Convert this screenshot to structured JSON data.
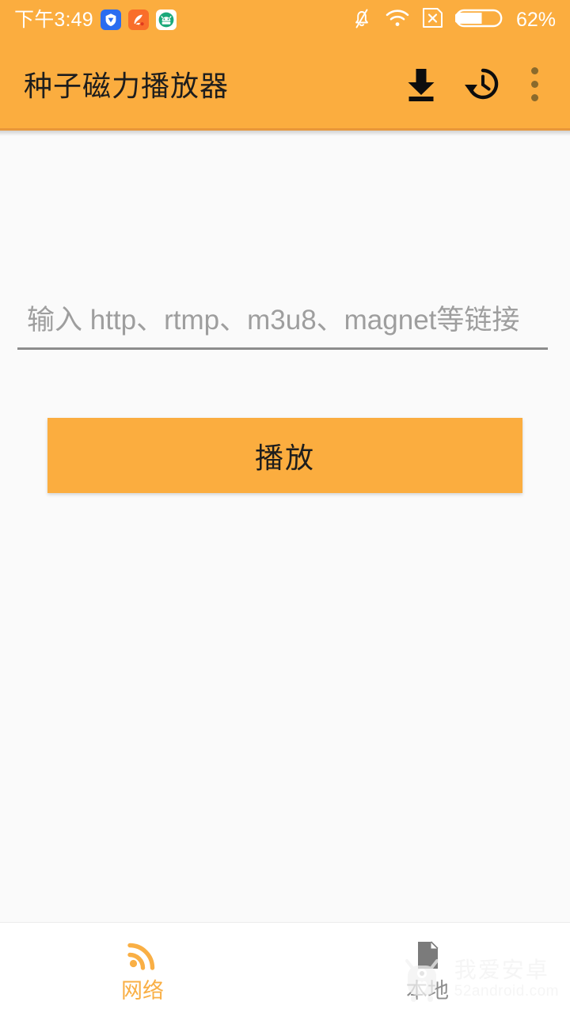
{
  "status_bar": {
    "clock": "下午3:49",
    "battery_percent": "62%",
    "tray_apps": [
      {
        "name": "shield-app-icon",
        "color": "#2a6cf0"
      },
      {
        "name": "uc-browser-app-icon",
        "color": "#f96e2a"
      },
      {
        "name": "android-green-app-icon",
        "color": "#1aa97a"
      }
    ],
    "right_icons": [
      {
        "name": "bell-muted-icon"
      },
      {
        "name": "wifi-icon"
      },
      {
        "name": "sim-card-disabled-icon"
      },
      {
        "name": "battery-icon"
      }
    ]
  },
  "toolbar": {
    "title": "种子磁力播放器",
    "background_color": "#FBAD3F",
    "actions": [
      {
        "name": "download-icon",
        "label": "下载"
      },
      {
        "name": "history-icon",
        "label": "历史"
      },
      {
        "name": "overflow-menu-icon",
        "label": "更多"
      }
    ]
  },
  "main": {
    "url_input": {
      "value": "",
      "placeholder": "输入 http、rtmp、m3u8、magnet等链接"
    },
    "play_button_label": "播放",
    "accent_color": "#FBAD3F"
  },
  "bottom_nav": {
    "items": [
      {
        "label": "网络",
        "icon": "rss-feed-icon",
        "active": true,
        "color": "#F9AF45"
      },
      {
        "label": "本地",
        "icon": "file-document-icon",
        "active": false,
        "color": "#8e8e8e"
      }
    ]
  },
  "watermark": {
    "title": "我爱安卓",
    "url": "52android.com",
    "icon": "android-mascot-icon"
  }
}
